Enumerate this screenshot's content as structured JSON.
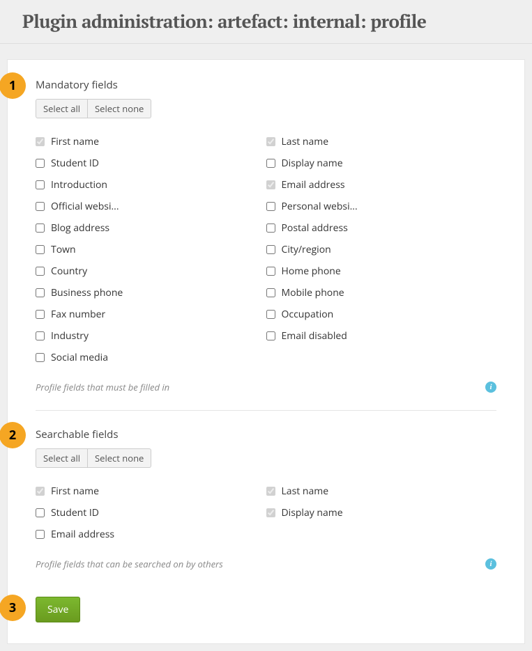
{
  "page": {
    "title": "Plugin administration: artefact: internal: profile"
  },
  "sections": {
    "mandatory": {
      "marker": "1",
      "title": "Mandatory fields",
      "select_all": "Select all",
      "select_none": "Select none",
      "help_text": "Profile fields that must be filled in",
      "fields": [
        {
          "label": "First name",
          "checked": true,
          "disabled": true
        },
        {
          "label": "Last name",
          "checked": true,
          "disabled": true
        },
        {
          "label": "Student ID",
          "checked": false,
          "disabled": false
        },
        {
          "label": "Display name",
          "checked": false,
          "disabled": false
        },
        {
          "label": "Introduction",
          "checked": false,
          "disabled": false
        },
        {
          "label": "Email address",
          "checked": true,
          "disabled": true
        },
        {
          "label": "Official websi...",
          "checked": false,
          "disabled": false
        },
        {
          "label": "Personal websi...",
          "checked": false,
          "disabled": false
        },
        {
          "label": "Blog address",
          "checked": false,
          "disabled": false
        },
        {
          "label": "Postal address",
          "checked": false,
          "disabled": false
        },
        {
          "label": "Town",
          "checked": false,
          "disabled": false
        },
        {
          "label": "City/region",
          "checked": false,
          "disabled": false
        },
        {
          "label": "Country",
          "checked": false,
          "disabled": false
        },
        {
          "label": "Home phone",
          "checked": false,
          "disabled": false
        },
        {
          "label": "Business phone",
          "checked": false,
          "disabled": false
        },
        {
          "label": "Mobile phone",
          "checked": false,
          "disabled": false
        },
        {
          "label": "Fax number",
          "checked": false,
          "disabled": false
        },
        {
          "label": "Occupation",
          "checked": false,
          "disabled": false
        },
        {
          "label": "Industry",
          "checked": false,
          "disabled": false
        },
        {
          "label": "Email disabled",
          "checked": false,
          "disabled": false
        },
        {
          "label": "Social media",
          "checked": false,
          "disabled": false
        }
      ]
    },
    "searchable": {
      "marker": "2",
      "title": "Searchable fields",
      "select_all": "Select all",
      "select_none": "Select none",
      "help_text": "Profile fields that can be searched on by others",
      "fields": [
        {
          "label": "First name",
          "checked": true,
          "disabled": true
        },
        {
          "label": "Last name",
          "checked": true,
          "disabled": true
        },
        {
          "label": "Student ID",
          "checked": false,
          "disabled": false
        },
        {
          "label": "Display name",
          "checked": true,
          "disabled": true
        },
        {
          "label": "Email address",
          "checked": false,
          "disabled": false
        }
      ]
    }
  },
  "save": {
    "marker": "3",
    "label": "Save"
  },
  "info_glyph": "i"
}
